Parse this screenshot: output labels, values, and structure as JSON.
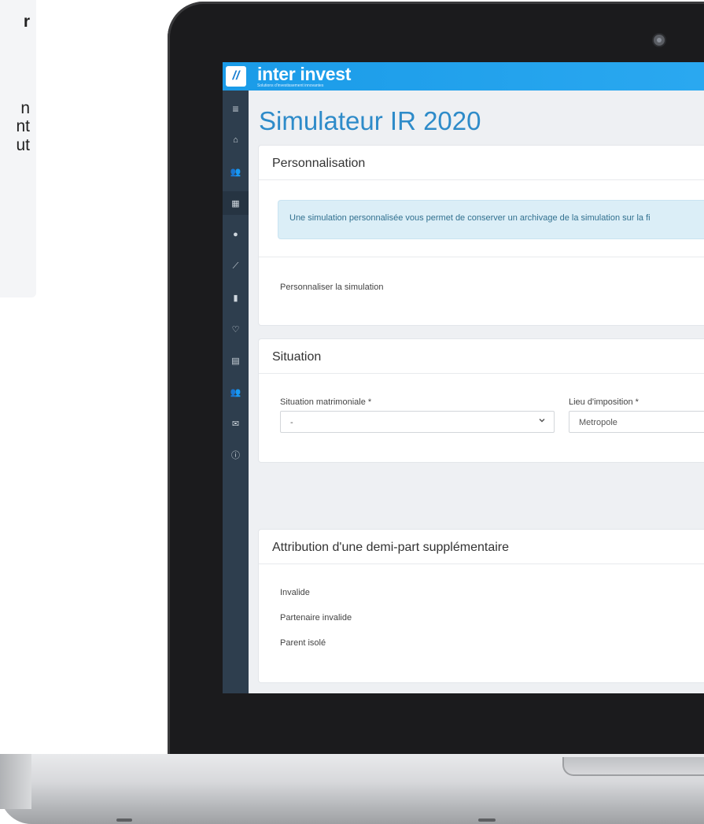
{
  "left_card": {
    "fragments": [
      "r",
      "n",
      "nt",
      "ut"
    ]
  },
  "app": {
    "brand": "inter invest",
    "brand_tagline": "Solutions d'investissement innovantes",
    "logo_mark": "//",
    "accent": "#1a9be8",
    "sidebar_bg": "#2e3e4e"
  },
  "sidebar": {
    "items": [
      {
        "icon": "menu-icon",
        "glyph": "≡"
      },
      {
        "icon": "home-icon",
        "glyph": "⌂"
      },
      {
        "icon": "users-icon",
        "glyph": "👥"
      },
      {
        "icon": "calculator-icon",
        "glyph": "▦"
      },
      {
        "icon": "globe-icon",
        "glyph": "●"
      },
      {
        "icon": "chart-line-icon",
        "glyph": "⟋"
      },
      {
        "icon": "building-icon",
        "glyph": "▮"
      },
      {
        "icon": "heart-icon",
        "glyph": "♡"
      },
      {
        "icon": "document-icon",
        "glyph": "▤"
      },
      {
        "icon": "group-icon",
        "glyph": "👥"
      },
      {
        "icon": "envelope-icon",
        "glyph": "✉"
      },
      {
        "icon": "info-icon",
        "glyph": "ⓘ"
      }
    ]
  },
  "page": {
    "title": "Simulateur IR 2020"
  },
  "personalisation": {
    "title": "Personnalisation",
    "alert": "Une simulation personnalisée vous permet de conserver un archivage de la simulation sur la fi",
    "toggle_label": "Personnaliser la simulation"
  },
  "situation": {
    "title": "Situation",
    "matrimoniale_label": "Situation matrimoniale *",
    "matrimoniale_value": "-",
    "lieu_label": "Lieu d'imposition *",
    "lieu_value": "Metropole"
  },
  "demi_part": {
    "title": "Attribution d'une demi-part supplémentaire",
    "items": [
      "Invalide",
      "Partenaire invalide",
      "Parent isolé"
    ]
  }
}
